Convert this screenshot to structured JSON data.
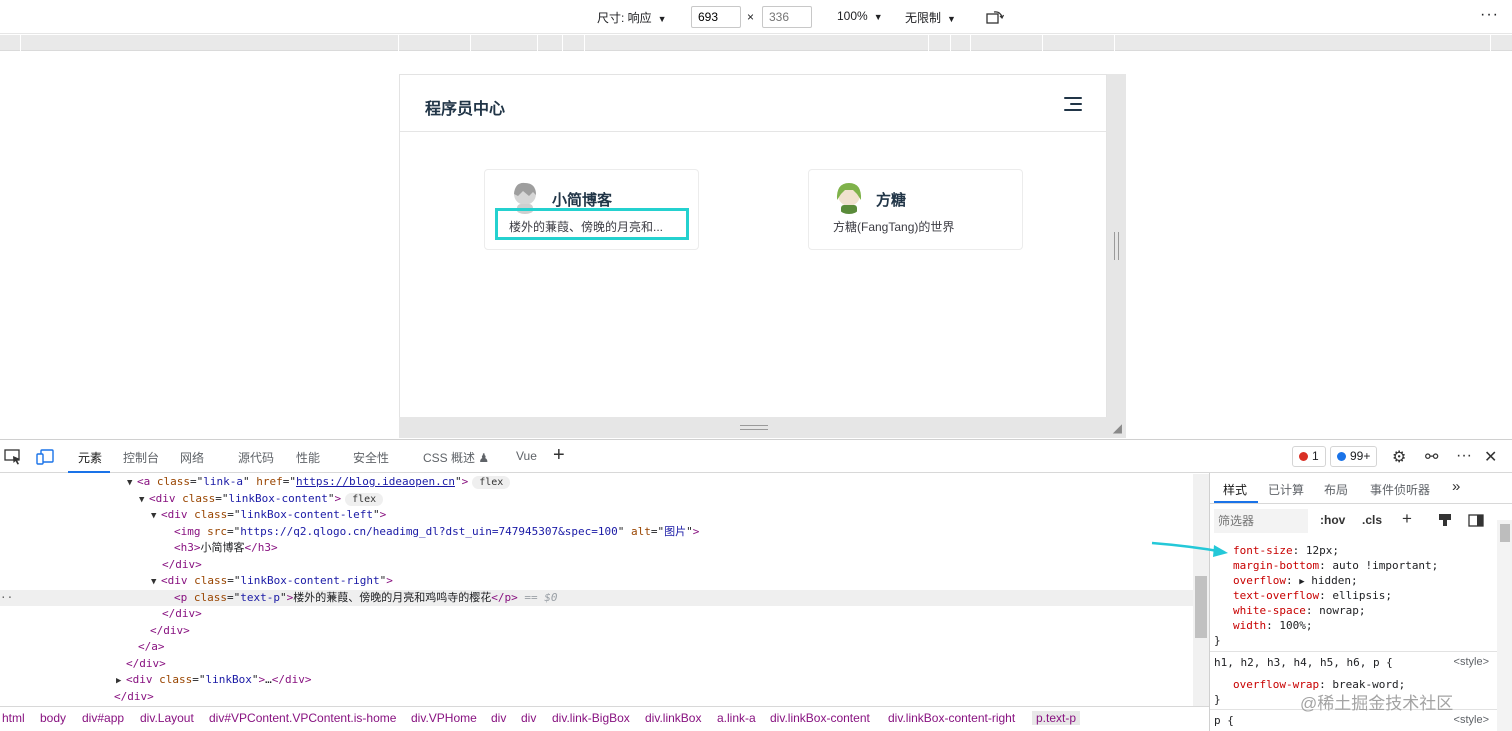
{
  "device_toolbar": {
    "dimensions_label": "尺寸: 响应",
    "width": "693",
    "height_placeholder": "336",
    "times": "×",
    "zoom": "100%",
    "throttle": "无限制",
    "more": "⋮"
  },
  "site": {
    "title": "程序员中心",
    "cards": [
      {
        "name": "小简博客",
        "desc": "楼外的蒹葭、傍晚的月亮和...",
        "avatar_color": "#b9b9b9"
      },
      {
        "name": "方糖",
        "desc": "方糖(FangTang)的世界",
        "avatar_color": "#7fb24a"
      }
    ]
  },
  "devtools": {
    "tabs": [
      "元素",
      "控制台",
      "网络",
      "源代码",
      "性能",
      "安全性",
      "CSS 概述",
      "Vue"
    ],
    "active_tab": "元素",
    "error_count": "1",
    "message_count": "99+",
    "colors": {
      "error": "#d93025",
      "info": "#1a73e8",
      "accent": "#1a73e8"
    }
  },
  "dom": {
    "line1": {
      "tag": "a",
      "attr1": "class",
      "val1": "link-a",
      "attr2": "href",
      "link": "https://blog.ideaopen.cn",
      "badge": "flex"
    },
    "line2": {
      "tag": "div",
      "attr": "class",
      "val": "linkBox-content",
      "badge": "flex"
    },
    "line3": {
      "tag": "div",
      "attr": "class",
      "val": "linkBox-content-left"
    },
    "line4": {
      "tag": "img",
      "attr1": "src",
      "val1": "https://q2.qlogo.cn/headimg_dl?dst_uin=747945307&spec=100",
      "attr2": "alt",
      "val2": "图片"
    },
    "line5": {
      "tag": "h3",
      "text": "小简博客"
    },
    "line6": {
      "tag": "div"
    },
    "line7": {
      "tag": "div",
      "attr": "class",
      "val": "linkBox-content-right"
    },
    "line8": {
      "tag": "p",
      "attr": "class",
      "val": "text-p",
      "text": "楼外的蒹葭、傍晚的月亮和鸡鸣寺的樱花",
      "marker": "== $0"
    },
    "line9": {
      "tag": "div"
    },
    "line10": {
      "tag": "div"
    },
    "line11": {
      "tag": "a"
    },
    "line12": {
      "tag": "div"
    },
    "line13": {
      "tag": "div",
      "attr": "class",
      "val": "linkBox",
      "ellipsis": "…"
    },
    "line14": {
      "tag": "div"
    }
  },
  "breadcrumb": [
    "html",
    "body",
    "div#app",
    "div.Layout",
    "div#VPContent.VPContent.is-home",
    "div.VPHome",
    "div",
    "div",
    "div.link-BigBox",
    "div.linkBox",
    "a.link-a",
    "div.linkBox-content",
    "div.linkBox-content-right",
    "p.text-p"
  ],
  "styles": {
    "tabs": [
      "样式",
      "已计算",
      "布局",
      "事件侦听器"
    ],
    "filter_placeholder": "筛选器",
    "hov": ":hov",
    "cls": ".cls",
    "rule1": [
      {
        "prop": "font-size",
        "val": "12px;"
      },
      {
        "prop": "margin-bottom",
        "val": "auto !important;"
      },
      {
        "prop": "overflow",
        "val": "hidden;"
      },
      {
        "prop": "text-overflow",
        "val": "ellipsis;"
      },
      {
        "prop": "white-space",
        "val": "nowrap;"
      },
      {
        "prop": "width",
        "val": "100%;"
      }
    ],
    "rule2_selector": "h1, h2, h3, h4, h5, h6, p {",
    "rule2_source": "<style>",
    "rule2_prop": "overflow-wrap",
    "rule2_val": "break-word;",
    "rule3_selector": "p {",
    "rule3_source": "<style>",
    "close_brace": "}"
  },
  "watermark": "@稀土掘金技术社区"
}
